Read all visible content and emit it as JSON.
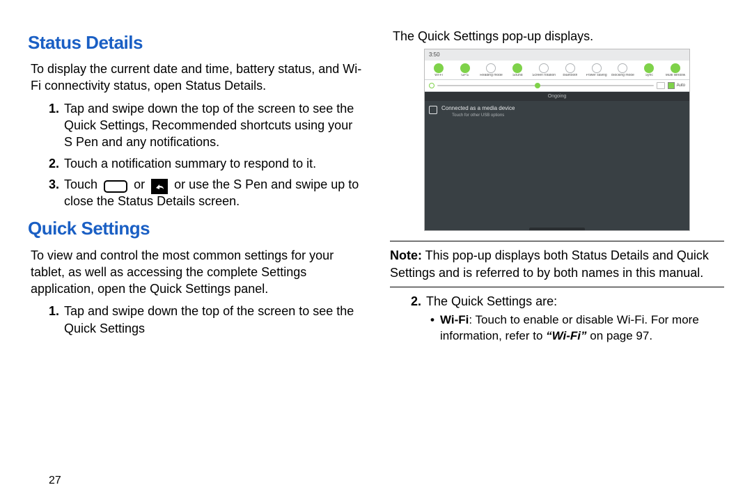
{
  "page_number": "27",
  "left": {
    "h_status": "Status Details",
    "status_intro": "To display the current date and time, battery status, and Wi-Fi connectivity status, open Status Details.",
    "status_steps": [
      "Tap and swipe down the top of the screen to see the Quick Settings, Recommended shortcuts using your S Pen and any notifications.",
      "Touch a notification summary to respond to it.",
      {
        "pre": "Touch ",
        "mid": " or ",
        "post": " or use the S Pen and swipe up to close the Status Details screen."
      }
    ],
    "h_quick": "Quick Settings",
    "quick_intro": "To view and control the most common settings for your tablet, as well as accessing the complete Settings application, open the Quick Settings panel.",
    "quick_step1": "Tap and swipe down the top of the screen to see the Quick Settings"
  },
  "right": {
    "caption": "The Quick Settings pop-up displays.",
    "screenshot": {
      "time": "3:50",
      "date_top": "",
      "date_sub": "",
      "auto_label": "Auto",
      "category": "Ongoing",
      "notif_title": "Connected as a media device",
      "notif_sub": "Touch for other USB options",
      "toggles": [
        {
          "label": "Wi-Fi",
          "on": true
        },
        {
          "label": "GPS",
          "on": true
        },
        {
          "label": "Reading mode",
          "on": false
        },
        {
          "label": "Sound",
          "on": true
        },
        {
          "label": "Screen rotation",
          "on": false
        },
        {
          "label": "Bluetooth",
          "on": false
        },
        {
          "label": "Power saving",
          "on": false
        },
        {
          "label": "Blocking mode",
          "on": false
        },
        {
          "label": "Sync",
          "on": true
        },
        {
          "label": "Multi window",
          "on": true
        }
      ]
    },
    "note_bold": "Note:",
    "note_text": " This pop-up displays both Status Details and Quick Settings and is referred to by both names in this manual.",
    "step2_lead": "The Quick Settings are:",
    "bullet_bold": "Wi-Fi",
    "bullet_text": ": Touch to enable or disable Wi-Fi. For more information, refer to ",
    "bullet_ref": "“Wi-Fi”",
    "bullet_tail": " on page 97."
  }
}
